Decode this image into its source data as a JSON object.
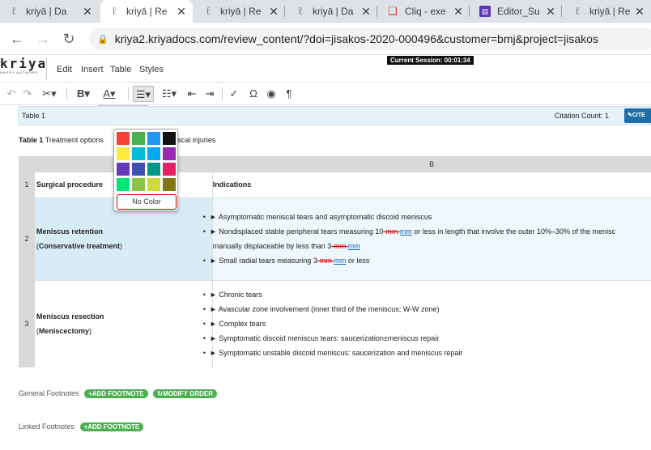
{
  "browser": {
    "tabs": [
      {
        "title": "kriyā | Da",
        "icon": "kriya-favicon"
      },
      {
        "title": "kriyā | Re",
        "icon": "kriya-favicon",
        "active": true
      },
      {
        "title": "kriyā | Re",
        "icon": "kriya-favicon"
      },
      {
        "title": "kriyā | Da",
        "icon": "kriya-favicon"
      },
      {
        "title": "Cliq - exe",
        "icon": "cliq-favicon"
      },
      {
        "title": "Editor_Su",
        "icon": "editor-favicon"
      },
      {
        "title": "kriyā | Re",
        "icon": "kriya-favicon"
      }
    ],
    "url": "kriya2.kriyadocs.com/review_content/?doi=jisakos-2020-000496&customer=bmj&project=jisakos"
  },
  "app": {
    "logo_text": "kriya",
    "logo_tagline": "HAPPY AUTHORS",
    "menu": [
      "Edit",
      "Insert",
      "Table",
      "Styles"
    ],
    "session_label": "Current Session: 00:01:34"
  },
  "table_header": {
    "label": "Table 1",
    "citation": "Citation Count: 1",
    "cite_button": "CITE"
  },
  "caption": {
    "bold": "Table 1",
    "text": " Treatment options ",
    "text_tail": "r meniscal injuries"
  },
  "palette": {
    "colors": [
      "#f44336",
      "#4caf50",
      "#2196f3",
      "#111111",
      "#ffeb3b",
      "#00bcd4",
      "#03a9f4",
      "#9c27b0",
      "#673ab7",
      "#3f51b5",
      "#009688",
      "#e91e63",
      "#00e676",
      "#8bc34a",
      "#cddc39",
      "#827717"
    ],
    "no_color_label": "No Color"
  },
  "grid": {
    "col_b_label": "B",
    "rows": [
      {
        "num": "1",
        "a": "Surgical procedure",
        "b": "Indications"
      },
      {
        "num": "2",
        "a_line1": "Meniscus retention",
        "a_line2": "Conservative treatment",
        "bullets": [
          "► Asymptomatic meniscal tears and asymptomatic discoid meniscus",
          "► Nondisplaced stable peripheral tears measuring 10",
          "► Small radial tears measuring 3"
        ],
        "b2_del": "-mm ",
        "b2_ins": "mm",
        "b2_tail": " or less in length that involve the outer 10%–30% of the menisc",
        "b2_line2": "manually displaceable by less than 3",
        "b2_del2": "-mm ",
        "b2_ins2": "mm",
        "b3_del": "-mm ",
        "b3_ins": "mm",
        "b3_tail": " or less"
      },
      {
        "num": "3",
        "a_line1": "Meniscus resection",
        "a_line2": "Meniscectomy",
        "bullets": [
          "► Chronic tears",
          "► Avascular zone involvement (inner third of the meniscus; W-W zone)",
          "► Complex tears",
          "► Symptomatic discoid meniscus tears: saucerization±meniscus repair",
          "► Symptomatic unstable discoid meniscus: saucerization and meniscus repair"
        ]
      }
    ]
  },
  "footnotes": {
    "general_label": "General Footnotes",
    "add_footnote": "ADD FOOTNOTE",
    "modify_order": "MODIFY ORDER",
    "linked_label": "Linked Footnotes"
  }
}
